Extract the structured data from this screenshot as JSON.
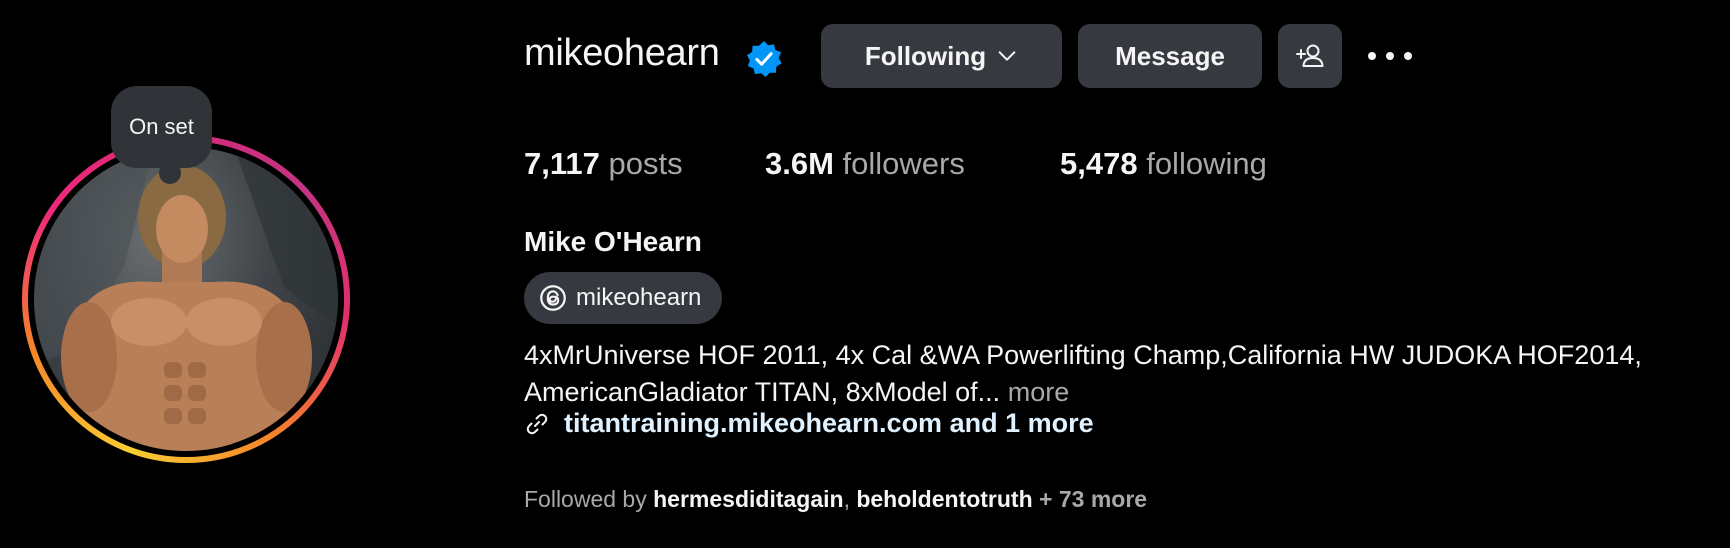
{
  "profile": {
    "username": "mikeohearn",
    "full_name": "Mike O'Hearn",
    "verified": true,
    "note": "On set",
    "threads_handle": "mikeohearn",
    "bio_text": "4xMrUniverse HOF 2011, 4x Cal &WA Powerlifting Champ,California HW JUDOKA HOF2014, AmericanGladiator TITAN, 8xModel of...",
    "bio_more": "more",
    "link": "titantraining.mikeohearn.com and 1 more"
  },
  "actions": {
    "following_label": "Following",
    "message_label": "Message"
  },
  "stats": {
    "posts_count": "7,117",
    "posts_label": "posts",
    "followers_count": "3.6M",
    "followers_label": "followers",
    "following_count": "5,478",
    "following_label": "following"
  },
  "followed_by": {
    "prefix": "Followed by",
    "user1": "hermesdiditagain",
    "separator": ",",
    "user2": "beholdentotruth",
    "more": "+ 73 more"
  },
  "icons": {
    "verified": "verified-badge-icon",
    "chevron": "chevron-down-icon",
    "add_user": "add-user-icon",
    "more": "more-horizontal-icon",
    "threads": "threads-icon",
    "link": "link-icon"
  },
  "colors": {
    "background": "#000000",
    "button_bg": "#363a40",
    "verified_blue": "#0095f6",
    "secondary_text": "#a8a8a8",
    "link_text": "#e0f1ff"
  }
}
